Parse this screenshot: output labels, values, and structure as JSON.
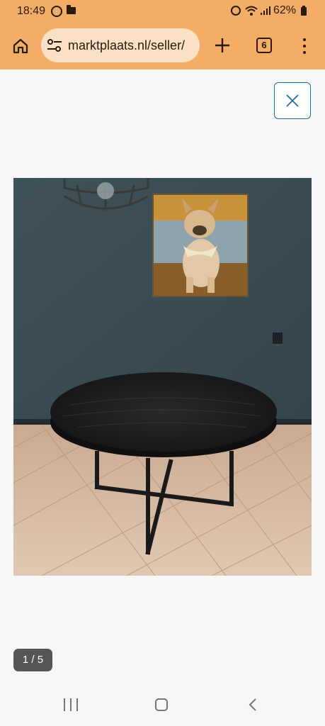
{
  "status_bar": {
    "time": "18:49",
    "battery": "62%",
    "icons": [
      "whatsapp-icon",
      "folder-icon",
      "alarm-icon",
      "wifi-icon",
      "signal-icon",
      "battery-icon"
    ]
  },
  "browser": {
    "url": "marktplaats.nl/seller/",
    "tab_count": "6",
    "accent_color": "#f3ad66",
    "url_bar_color": "#fbe1c4"
  },
  "viewer": {
    "close_color": "#1e6fa3",
    "counter": "1 / 5",
    "photo": "photo-round-dining-table"
  },
  "nav_bar": {
    "buttons": [
      "recent-apps",
      "home",
      "back"
    ]
  }
}
